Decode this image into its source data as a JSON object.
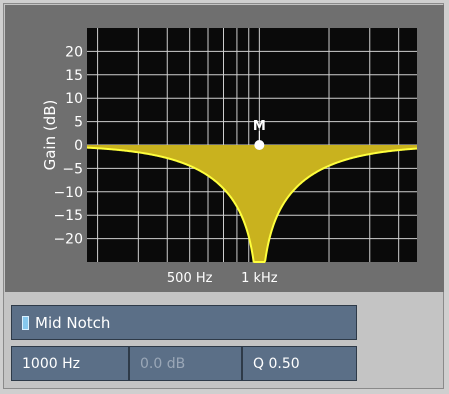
{
  "chart_data": {
    "type": "line",
    "title": "",
    "xlabel": "",
    "ylabel": "Gain (dB)",
    "x_scale": "log",
    "xlim": [
      180,
      4800
    ],
    "ylim": [
      -25,
      25
    ],
    "y_ticks": [
      "20",
      "15",
      "10",
      "5",
      "0",
      "−5",
      "−10",
      "−15",
      "−20"
    ],
    "y_tick_values": [
      20,
      15,
      10,
      5,
      0,
      -5,
      -10,
      -15,
      -20
    ],
    "x_tick_labels": [
      "500 Hz",
      "1 kHz"
    ],
    "x_tick_values": [
      500,
      1000
    ],
    "x_gridlines": [
      200,
      300,
      400,
      500,
      600,
      700,
      800,
      900,
      1000,
      2000,
      3000,
      4000
    ],
    "grid": true,
    "series": [
      {
        "type": "notch",
        "center_hz": 1000,
        "q": 0.5,
        "fill_color": "#c9b21e",
        "line_color": "#ffff3c"
      }
    ],
    "marker": {
      "label": "M",
      "x": 1000,
      "y": 0
    }
  },
  "band": {
    "name": "Mid Notch",
    "swatch_color": "#86c8ee"
  },
  "params": {
    "frequency": "1000 Hz",
    "gain": "0.0 dB",
    "q": "Q 0.50"
  },
  "colors": {
    "plot_background": "#0a0a0a",
    "grid": "#cfcfcf",
    "panel": "#6f6f6f",
    "control": "#5b6f87"
  }
}
